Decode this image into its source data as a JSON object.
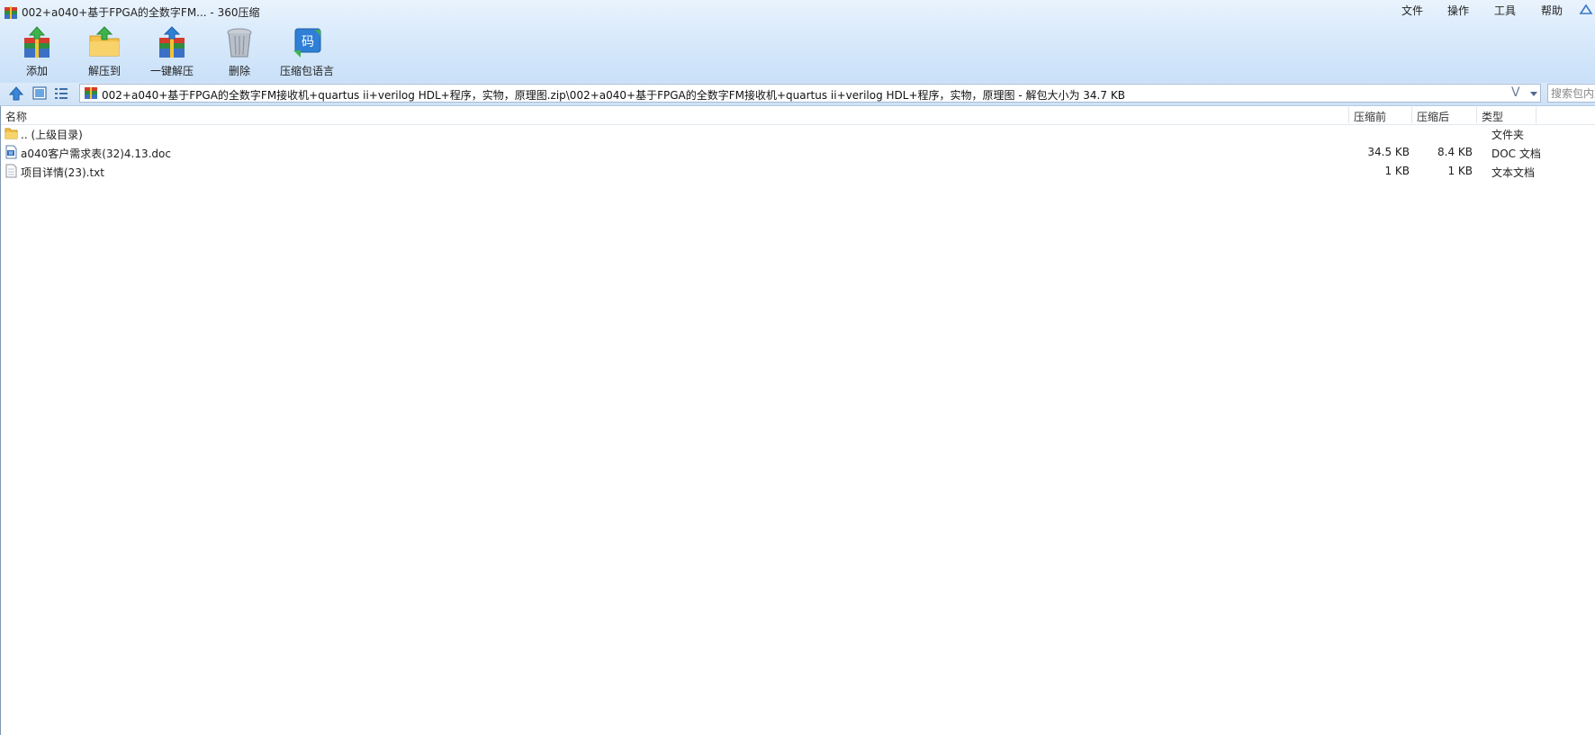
{
  "window": {
    "title": "002+a040+基于FPGA的全数字FM... - 360压缩"
  },
  "menu": [
    "文件",
    "操作",
    "工具",
    "帮助"
  ],
  "toolbar": {
    "add": "添加",
    "extract_to": "解压到",
    "one_click_extract": "一键解压",
    "delete": "删除",
    "archive_language": "压缩包语言",
    "language_icon_glyph": "码"
  },
  "address": {
    "path": "002+a040+基于FPGA的全数字FM接收机+quartus ii+verilog HDL+程序，实物，原理图.zip\\002+a040+基于FPGA的全数字FM接收机+quartus ii+verilog HDL+程序，实物，原理图 - 解包大小为 34.7 KB",
    "v_label": "V"
  },
  "search": {
    "placeholder": "搜索包内文件"
  },
  "columns": {
    "name": "名称",
    "compressed_before": "压缩前",
    "compressed_after": "压缩后",
    "type": "类型"
  },
  "rows": [
    {
      "name": ".. (上级目录)",
      "before": "",
      "after": "",
      "type": "文件夹",
      "icon": "folder-icon"
    },
    {
      "name": "a040客户需求表(32)4.13.doc",
      "before": "34.5 KB",
      "after": "8.4 KB",
      "type": "DOC 文档",
      "icon": "doc-file-icon"
    },
    {
      "name": "项目详情(23).txt",
      "before": "1 KB",
      "after": "1 KB",
      "type": "文本文档",
      "icon": "text-file-icon"
    }
  ],
  "colors": {
    "toolbar_gradient_top": "#e9f3fd",
    "toolbar_gradient_bottom": "#c9e0f8",
    "accent_blue": "#2f7fd6"
  }
}
